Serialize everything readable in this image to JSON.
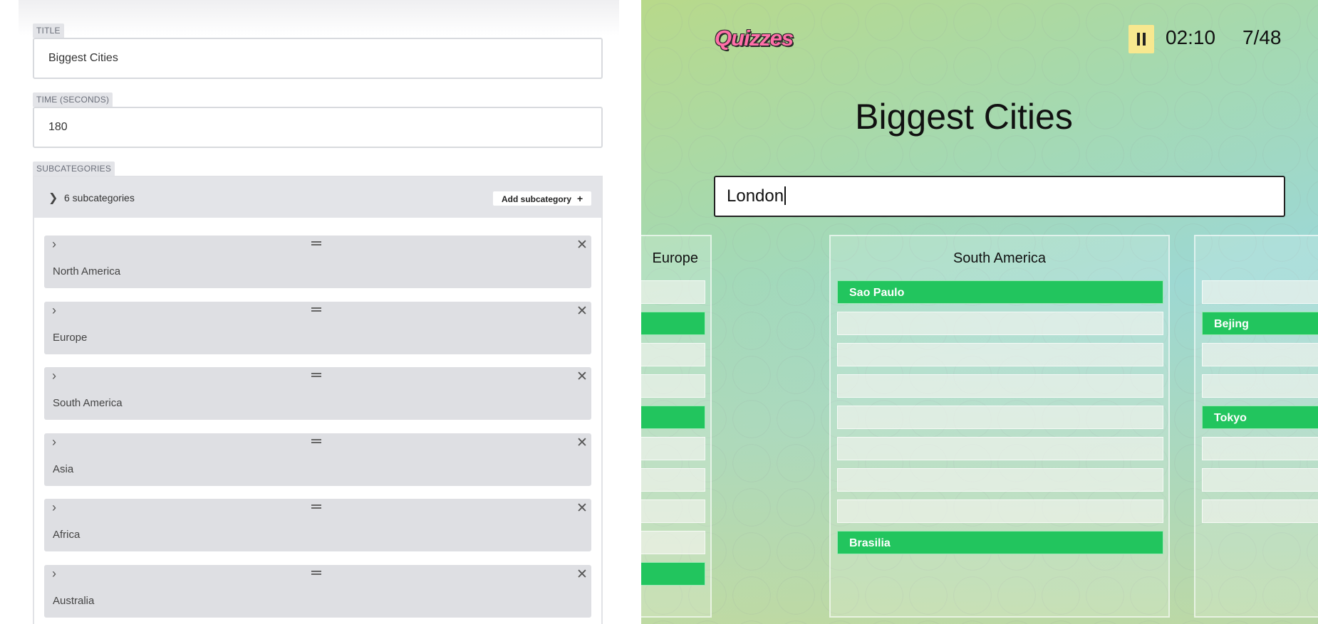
{
  "editor": {
    "title_tag": "TITLE",
    "title_value": "Biggest Cities",
    "time_tag": "TIME (SECONDS)",
    "time_value": "180",
    "subcategories_tag": "SUBCATEGORIES",
    "subcategories_count": "6 subcategories",
    "add_subcategory_label": "Add subcategory",
    "subcategories": [
      {
        "name": "North America"
      },
      {
        "name": "Europe"
      },
      {
        "name": "South America"
      },
      {
        "name": "Asia"
      },
      {
        "name": "Africa"
      },
      {
        "name": "Australia"
      }
    ]
  },
  "quiz": {
    "logo_text": "Quizzes",
    "timer": "02:10",
    "score": "7/48",
    "title": "Biggest Cities",
    "answer_value": "London",
    "columns": [
      {
        "title": "Europe",
        "slots": [
          "",
          "found",
          "",
          "",
          "found",
          "",
          "",
          "",
          "",
          "found"
        ],
        "labels": [
          "",
          "",
          "",
          "",
          "",
          "",
          "",
          "",
          "",
          ""
        ]
      },
      {
        "title": "South America",
        "slots": [
          "found",
          "",
          "",
          "",
          "",
          "",
          "",
          "",
          "found"
        ],
        "labels": [
          "Sao Paulo",
          "",
          "",
          "",
          "",
          "",
          "",
          "",
          "Brasilia"
        ]
      },
      {
        "title": "",
        "slots": [
          "",
          "found",
          "",
          "",
          "found",
          "",
          "",
          ""
        ],
        "labels": [
          "",
          "Bejing",
          "",
          "",
          "Tokyo",
          "",
          "",
          ""
        ]
      }
    ],
    "colors": {
      "found": "#22c55e",
      "accent": "#f8e88f"
    }
  }
}
